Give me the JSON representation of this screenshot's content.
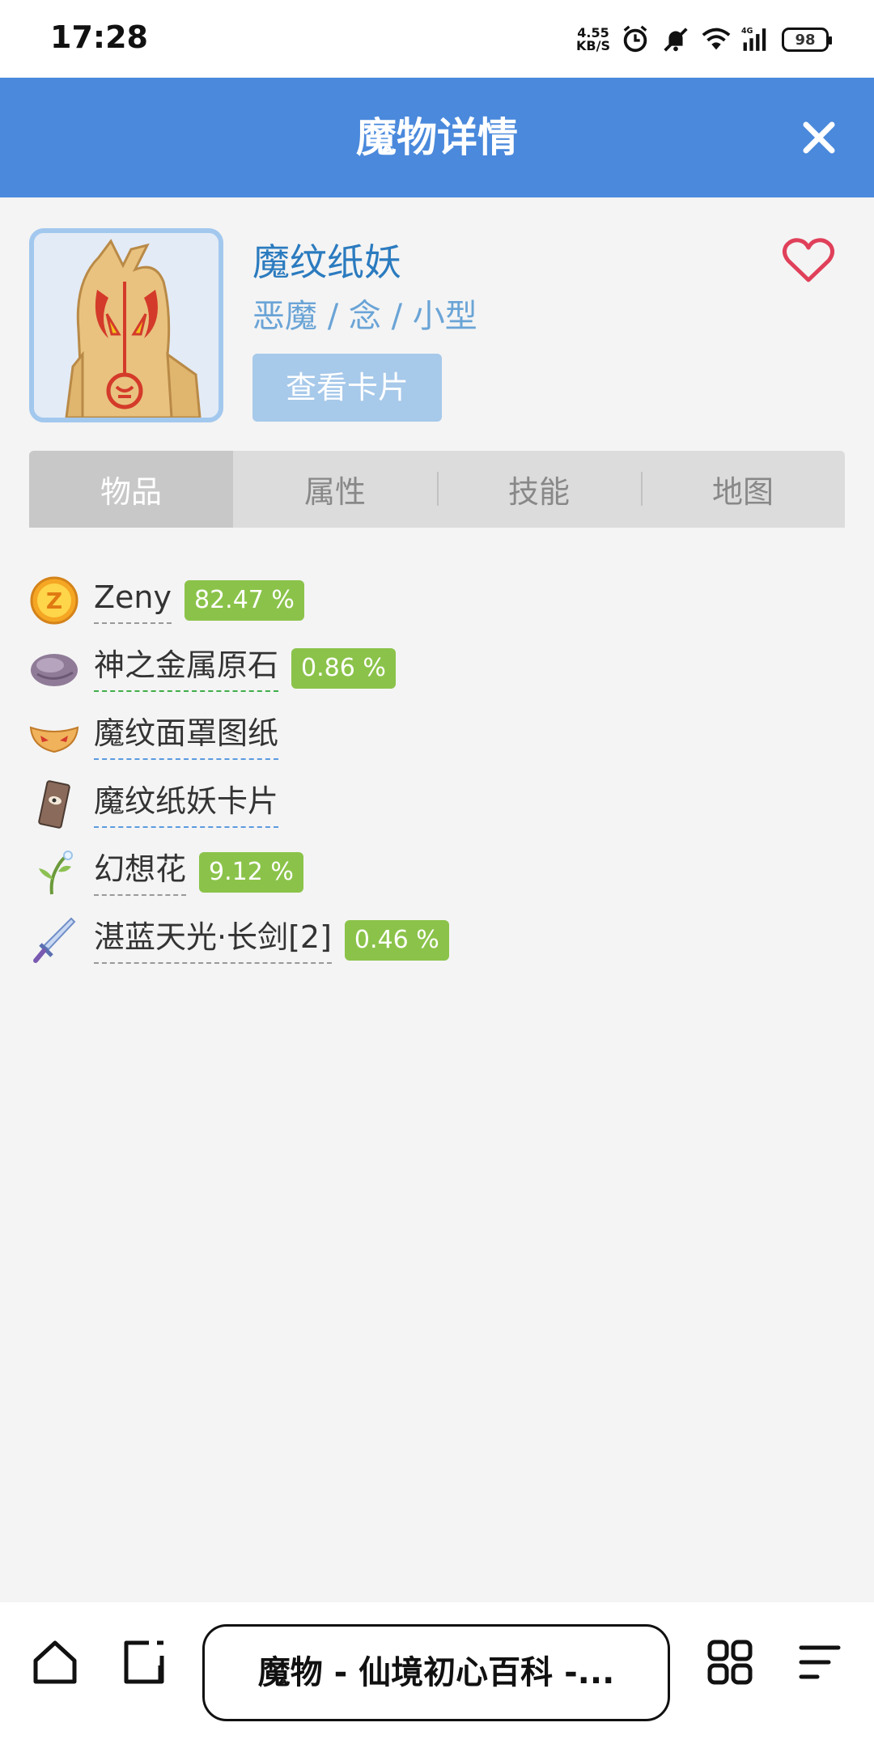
{
  "status_bar": {
    "time": "17:28",
    "net_speed_value": "4.55",
    "net_speed_unit": "KB/S",
    "network": "4G",
    "battery": "98",
    "icons": [
      "alarm-icon",
      "mute-icon",
      "wifi-icon",
      "signal-icon",
      "battery-icon"
    ]
  },
  "header": {
    "title": "魔物详情",
    "close_icon": "close-icon"
  },
  "monster": {
    "name": "魔纹纸妖",
    "tags": "恶魔 / 念 / 小型",
    "view_card_label": "查看卡片",
    "favorite_icon": "heart-outline-icon"
  },
  "tabs": [
    {
      "label": "物品",
      "active": true
    },
    {
      "label": "属性",
      "active": false
    },
    {
      "label": "技能",
      "active": false
    },
    {
      "label": "地图",
      "active": false
    }
  ],
  "items": [
    {
      "name": "Zeny",
      "rate": "82.47 %",
      "icon": "zeny-coin-icon"
    },
    {
      "name": "神之金属原石",
      "rate": "0.86 %",
      "icon": "ore-icon"
    },
    {
      "name": "魔纹面罩图纸",
      "rate": "",
      "icon": "mask-icon"
    },
    {
      "name": "魔纹纸妖卡片",
      "rate": "",
      "icon": "card-icon"
    },
    {
      "name": "幻想花",
      "rate": "9.12 %",
      "icon": "flower-icon"
    },
    {
      "name": "湛蓝天光·长剑[2]",
      "rate": "0.46 %",
      "icon": "sword-icon"
    }
  ],
  "colors": {
    "header_bg": "#4a89dc",
    "name_text": "#2b7bbf",
    "rate_badge": "#8bc34a",
    "favorite": "#e0405a"
  },
  "bottom_bar": {
    "url_label": "魔物 - 仙境初心百科 -...",
    "icons": [
      "home-icon",
      "tabs-icon",
      "apps-icon",
      "menu-icon"
    ]
  }
}
